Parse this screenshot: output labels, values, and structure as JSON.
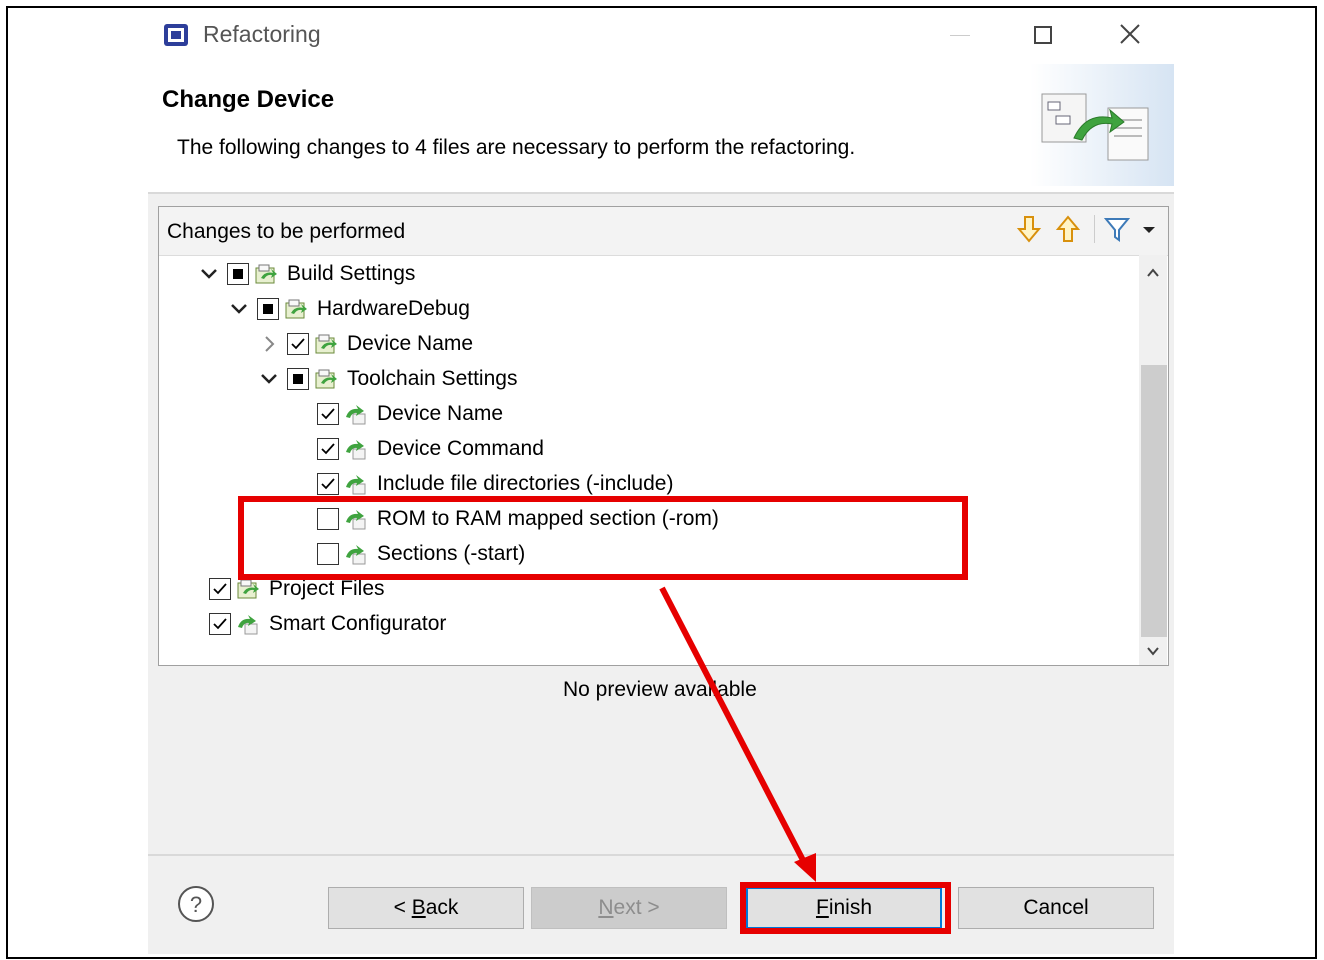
{
  "window": {
    "title": "Refactoring"
  },
  "header": {
    "title": "Change Device",
    "description": "The following changes to 4 files are necessary to perform the refactoring."
  },
  "changes_panel": {
    "title": "Changes to be performed",
    "toolbar": [
      "arrow-down-icon",
      "arrow-up-icon",
      "filter-icon",
      "dropdown-icon"
    ],
    "tree": [
      {
        "label": "Build Settings",
        "checkbox": "partial",
        "expanded": true,
        "level": 0
      },
      {
        "label": "HardwareDebug",
        "checkbox": "partial",
        "expanded": true,
        "level": 1
      },
      {
        "label": "Device Name",
        "checkbox": "checked",
        "expanded": false,
        "level": 2
      },
      {
        "label": "Toolchain Settings",
        "checkbox": "partial",
        "expanded": true,
        "level": 2
      },
      {
        "label": "Device Name",
        "checkbox": "checked",
        "level": 3
      },
      {
        "label": "Device Command",
        "checkbox": "checked",
        "level": 3
      },
      {
        "label": "Include file directories (-include)",
        "checkbox": "checked",
        "level": 3
      },
      {
        "label": "ROM to RAM mapped section (-rom)",
        "checkbox": "unchecked",
        "level": 3
      },
      {
        "label": "Sections (-start)",
        "checkbox": "unchecked",
        "level": 3
      },
      {
        "label": "Project Files",
        "checkbox": "checked",
        "level": 0
      },
      {
        "label": "Smart Configurator",
        "checkbox": "checked",
        "level": 0
      }
    ]
  },
  "preview": {
    "text": "No preview available"
  },
  "buttons": {
    "back_prefix": "< ",
    "back_mnemonic": "B",
    "back_rest": "ack",
    "next_mnemonic": "N",
    "next_rest": "ext >",
    "finish_mnemonic": "F",
    "finish_rest": "inish",
    "cancel": "Cancel"
  },
  "colors": {
    "highlight": "#e60000",
    "accent": "#0078d7"
  }
}
